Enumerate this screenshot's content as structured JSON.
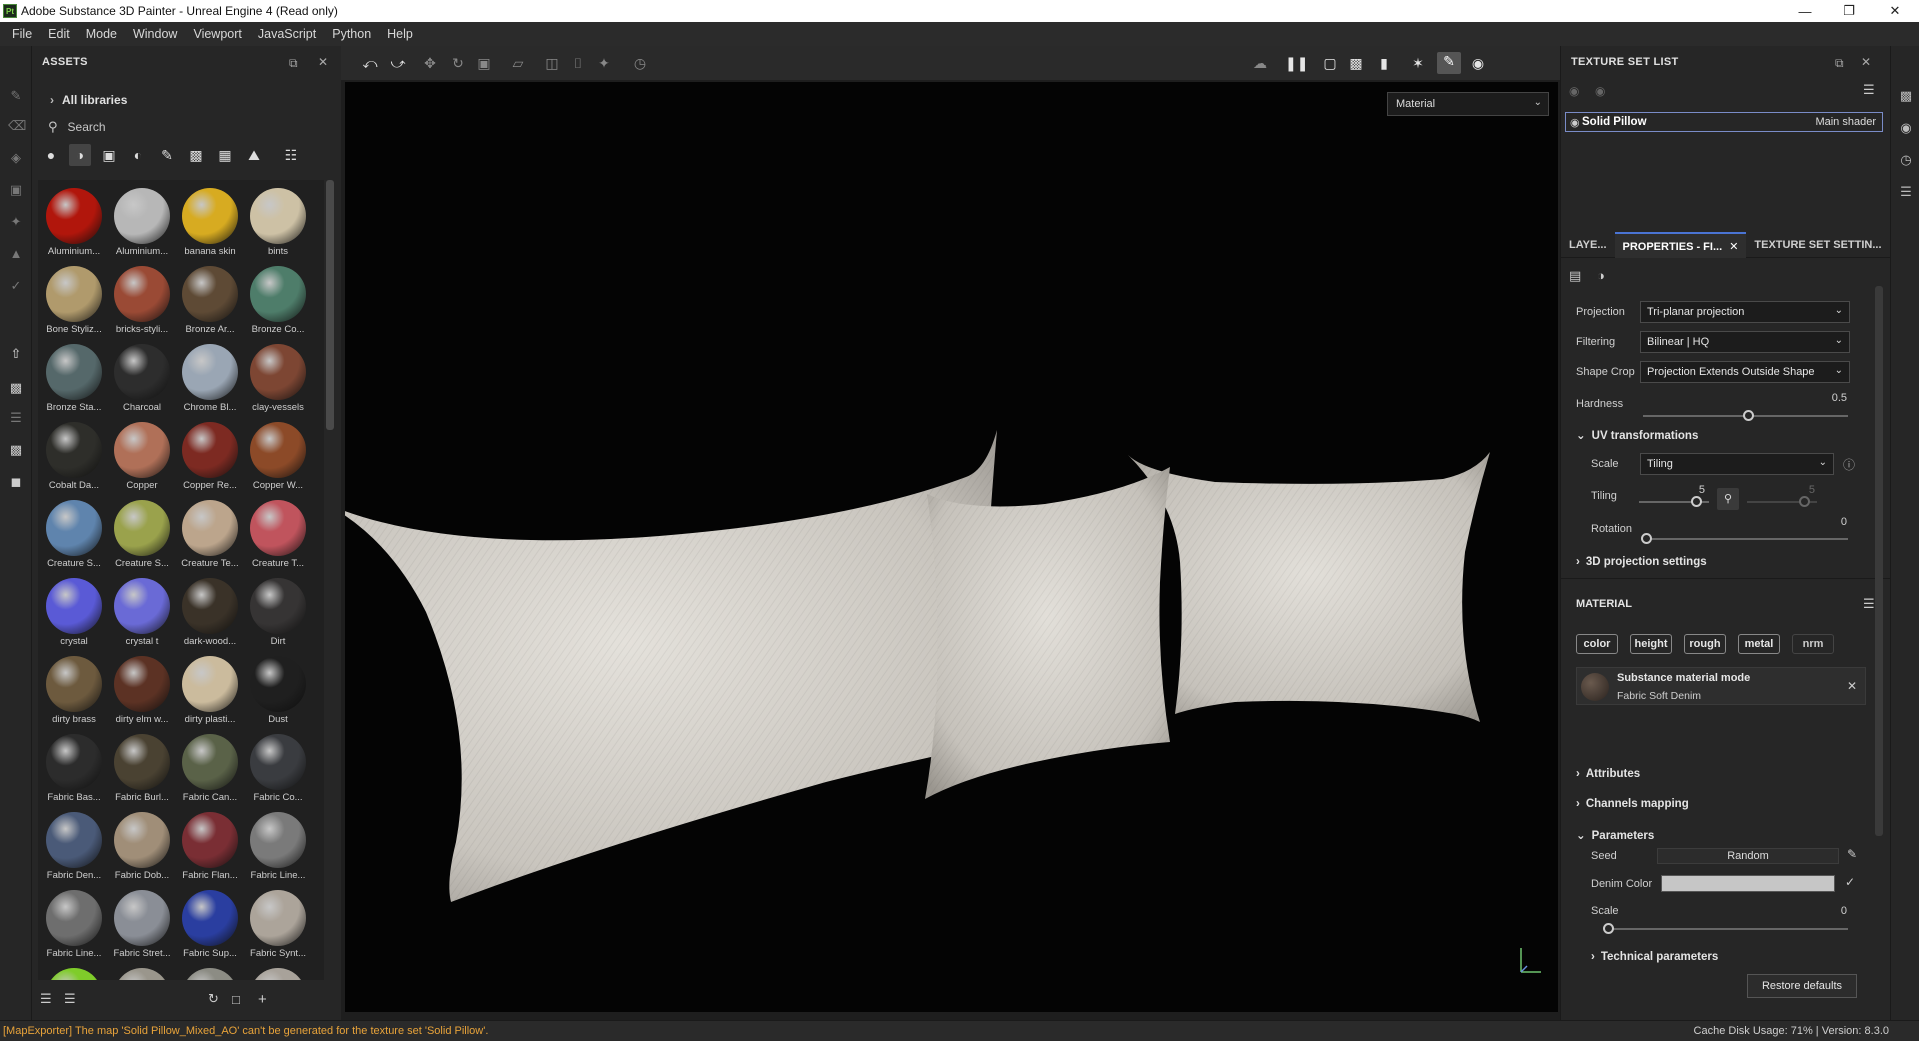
{
  "window": {
    "title": "Adobe Substance 3D Painter - Unreal Engine 4 (Read only)",
    "app_icon_text": "Pt"
  },
  "menu": [
    "File",
    "Edit",
    "Mode",
    "Window",
    "Viewport",
    "JavaScript",
    "Python",
    "Help"
  ],
  "assets": {
    "title": "ASSETS",
    "libraries_label": "All libraries",
    "search_placeholder": "Search",
    "materials": [
      {
        "label": "Aluminium...",
        "color": "#b1160c"
      },
      {
        "label": "Aluminium...",
        "color": "#b7b7b7"
      },
      {
        "label": "banana skin",
        "color": "#d7ab21"
      },
      {
        "label": "bints",
        "color": "#cdc1a5"
      },
      {
        "label": "Bone Styliz...",
        "color": "#b09a6c"
      },
      {
        "label": "bricks-styli...",
        "color": "#9a4a35"
      },
      {
        "label": "Bronze Ar...",
        "color": "#5e4a35"
      },
      {
        "label": "Bronze Co...",
        "color": "#4e7d6a"
      },
      {
        "label": "Bronze Sta...",
        "color": "#55686a"
      },
      {
        "label": "Charcoal",
        "color": "#2d2d2d"
      },
      {
        "label": "Chrome Bl...",
        "color": "#9aa6b4"
      },
      {
        "label": "clay-vessels",
        "color": "#7d4633"
      },
      {
        "label": "Cobalt Da...",
        "color": "#2e2e2a"
      },
      {
        "label": "Copper",
        "color": "#b07058"
      },
      {
        "label": "Copper Re...",
        "color": "#7d2a22"
      },
      {
        "label": "Copper W...",
        "color": "#8c4a28"
      },
      {
        "label": "Creature S...",
        "color": "#5f84ad"
      },
      {
        "label": "Creature S...",
        "color": "#9aa24c"
      },
      {
        "label": "Creature Te...",
        "color": "#bca58c"
      },
      {
        "label": "Creature T...",
        "color": "#c0545d"
      },
      {
        "label": "crystal",
        "color": "#5a5ad6"
      },
      {
        "label": "crystal t",
        "color": "#6a6ad6"
      },
      {
        "label": "dark-wood...",
        "color": "#3a3228"
      },
      {
        "label": "Dirt",
        "color": "#363434"
      },
      {
        "label": "dirty brass",
        "color": "#6d5a3e"
      },
      {
        "label": "dirty elm w...",
        "color": "#5c3224"
      },
      {
        "label": "dirty plasti...",
        "color": "#cbbb9d"
      },
      {
        "label": "Dust",
        "color": "#1f1f1f"
      },
      {
        "label": "Fabric Bas...",
        "color": "#2c2c2c"
      },
      {
        "label": "Fabric Burl...",
        "color": "#4a4232"
      },
      {
        "label": "Fabric Can...",
        "color": "#5a6248"
      },
      {
        "label": "Fabric Co...",
        "color": "#3a3c40"
      },
      {
        "label": "Fabric Den...",
        "color": "#4a5a78"
      },
      {
        "label": "Fabric Dob...",
        "color": "#a08e78"
      },
      {
        "label": "Fabric Flan...",
        "color": "#7a2e34"
      },
      {
        "label": "Fabric Line...",
        "color": "#7a7a7a"
      },
      {
        "label": "Fabric Line...",
        "color": "#6e6e6e"
      },
      {
        "label": "Fabric Stret...",
        "color": "#8a8e96"
      },
      {
        "label": "Fabric Sup...",
        "color": "#2a3ea0"
      },
      {
        "label": "Fabric Synt...",
        "color": "#aca49a"
      },
      {
        "label": "",
        "color": "#7fcc2a"
      },
      {
        "label": "",
        "color": "#9a968c"
      },
      {
        "label": "",
        "color": "#8c8c84"
      },
      {
        "label": "",
        "color": "#a8a29a"
      }
    ]
  },
  "viewport": {
    "mode_select": "Material"
  },
  "texture_set_list": {
    "title": "TEXTURE SET LIST",
    "item_name": "Solid Pillow",
    "item_shader": "Main shader"
  },
  "tabs": [
    "LAYE...",
    "PROPERTIES - FI...",
    "TEXTURE SET SETTIN..."
  ],
  "properties": {
    "projection_label": "Projection",
    "projection_value": "Tri-planar projection",
    "filtering_label": "Filtering",
    "filtering_value": "Bilinear | HQ",
    "shapecrop_label": "Shape Crop",
    "shapecrop_value": "Projection Extends Outside Shape",
    "hardness_label": "Hardness",
    "hardness_value": "0.5",
    "uv_label": "UV transformations",
    "scale_label": "Scale",
    "scale_value": "Tiling",
    "tiling_label": "Tiling",
    "tiling_value": "5",
    "tiling_value2": "5",
    "rotation_label": "Rotation",
    "rotation_value": "0",
    "proj3d_label": "3D projection settings"
  },
  "material": {
    "title": "MATERIAL",
    "channels": [
      "color",
      "height",
      "rough",
      "metal",
      "nrm"
    ],
    "mode_title": "Substance material mode",
    "mode_name": "Fabric Soft Denim",
    "attributes_label": "Attributes",
    "channels_mapping_label": "Channels mapping",
    "parameters_label": "Parameters",
    "seed_label": "Seed",
    "seed_value": "Random",
    "denim_label": "Denim Color",
    "denim_color": "#c6c6c6",
    "scale_label": "Scale",
    "scale_value": "0",
    "technical_label": "Technical parameters",
    "restore_label": "Restore defaults"
  },
  "status": {
    "message": "[MapExporter] The map 'Solid Pillow_Mixed_AO' can't be generated for the texture set 'Solid Pillow'.",
    "right": "Cache Disk Usage:   71% | Version: 8.3.0"
  }
}
